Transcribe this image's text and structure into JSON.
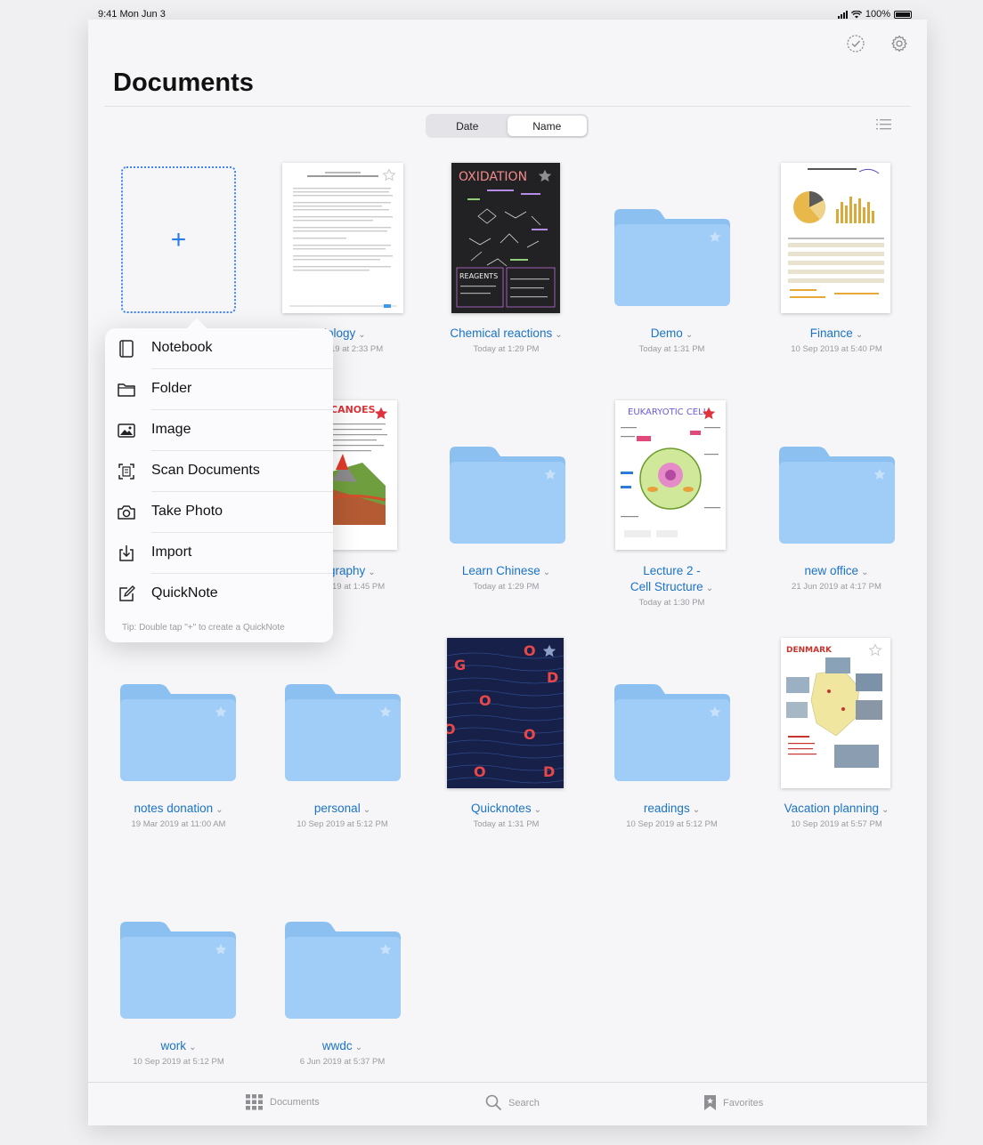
{
  "status": {
    "time": "9:41 Mon Jun 3",
    "battery": "100%"
  },
  "header": {
    "title": "Documents"
  },
  "sort": {
    "options": [
      "Date",
      "Name"
    ],
    "selected": "Name"
  },
  "new_document": {
    "plus": "+"
  },
  "popover": {
    "items": [
      {
        "label": "Notebook",
        "icon": "notebook-icon"
      },
      {
        "label": "Folder",
        "icon": "folder-icon"
      },
      {
        "label": "Image",
        "icon": "image-icon"
      },
      {
        "label": "Scan Documents",
        "icon": "scan-icon"
      },
      {
        "label": "Take Photo",
        "icon": "camera-icon"
      },
      {
        "label": "Import",
        "icon": "import-icon"
      },
      {
        "label": "QuickNote",
        "icon": "quicknote-icon"
      }
    ],
    "tip": "Tip: Double tap \"+\" to create a QuickNote"
  },
  "documents": {
    "partial_biology": {
      "name": "iology",
      "date": "19 at 2:33 PM"
    },
    "chemical": {
      "name": "Chemical reactions",
      "date": "Today at 1:29 PM",
      "thumb_title": "OXIDATION",
      "thumb_label": "REAGENTS"
    },
    "demo": {
      "name": "Demo",
      "date": "Today at 1:31 PM"
    },
    "finance": {
      "name": "Finance",
      "date": "10 Sep 2019 at 5:40 PM"
    },
    "partial_geography": {
      "name": "graphy",
      "date": "19 at 1:45 PM",
      "thumb_title": "CANOES"
    },
    "learn_chinese": {
      "name": "Learn Chinese",
      "date": "Today at 1:29 PM"
    },
    "lecture2": {
      "name_line1": "Lecture 2 -",
      "name_line2": "Cell Structure",
      "date": "Today at 1:30 PM",
      "thumb_title": "EUKARYOTIC CELL"
    },
    "new_office": {
      "name": "new office",
      "date": "21 Jun 2019 at 4:17 PM"
    },
    "notes_donation": {
      "name": "notes donation",
      "date": "19 Mar 2019 at 11:00 AM"
    },
    "personal": {
      "name": "personal",
      "date": "10 Sep 2019 at 5:12 PM"
    },
    "quicknotes": {
      "name": "Quicknotes",
      "date": "Today at 1:31 PM"
    },
    "readings": {
      "name": "readings",
      "date": "10 Sep 2019 at 5:12 PM"
    },
    "vacation": {
      "name": "Vacation planning",
      "date": "10 Sep 2019 at 5:57 PM",
      "thumb_title": "DENMARK"
    },
    "work": {
      "name": "work",
      "date": "10 Sep 2019 at 5:12 PM"
    },
    "wwdc": {
      "name": "wwdc",
      "date": "6 Jun 2019 at 5:37 PM"
    }
  },
  "tabbar": {
    "documents": "Documents",
    "search": "Search",
    "favorites": "Favorites"
  },
  "colors": {
    "accent": "#1a73c8",
    "folder": "#9fcdf7",
    "folder_tab": "#8cc0f0"
  }
}
